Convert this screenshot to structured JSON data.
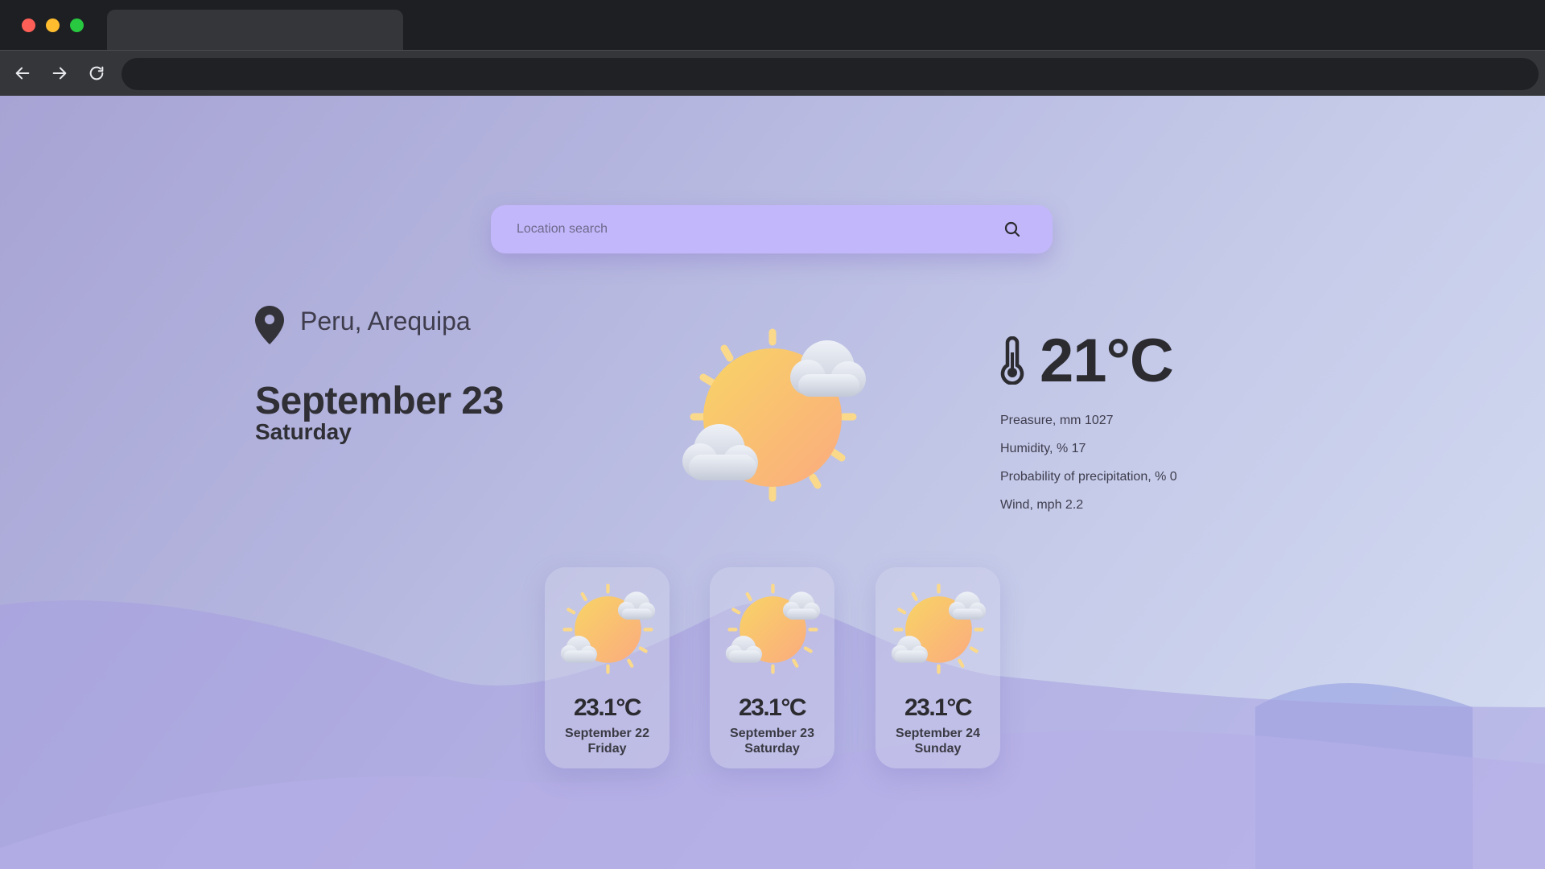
{
  "search": {
    "placeholder": "Location search",
    "value": ""
  },
  "location": {
    "text": "Peru, Arequipa",
    "icon": "map-pin-icon"
  },
  "today": {
    "date": "September 23",
    "day": "Saturday",
    "weather_icon": "sun-with-clouds-icon",
    "temperature": "21°C"
  },
  "details": [
    {
      "text": "Preasure, mm 1027"
    },
    {
      "text": "Humidity, % 17"
    },
    {
      "text": "Probability of precipitation, % 0"
    },
    {
      "text": "Wind, mph 2.2"
    }
  ],
  "forecast": [
    {
      "temp": "23.1°C",
      "date": "September 22",
      "day": "Friday",
      "icon": "sun-with-clouds-icon"
    },
    {
      "temp": "23.1°C",
      "date": "September 23",
      "day": "Saturday",
      "icon": "sun-with-clouds-icon"
    },
    {
      "temp": "23.1°C",
      "date": "September 24",
      "day": "Sunday",
      "icon": "sun-with-clouds-icon"
    }
  ],
  "colors": {
    "search_bg": "#c3b7fb",
    "text_dark": "#2f2f35",
    "sun_gradient": [
      "#f8cf6a",
      "#fbb07a"
    ],
    "chrome_dark": "#1e1f22"
  }
}
